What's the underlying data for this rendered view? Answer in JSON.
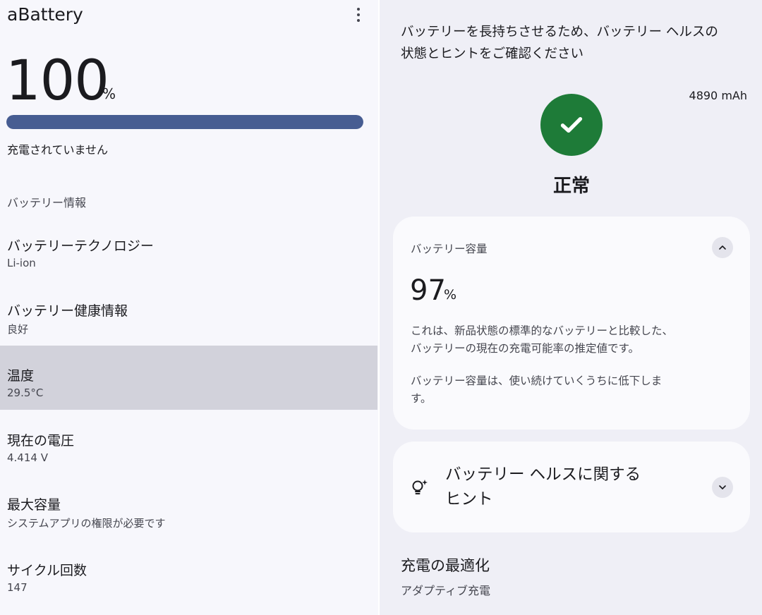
{
  "app": {
    "title": "aBattery"
  },
  "level": {
    "percent_value": "100",
    "percent_sign": "%",
    "fill_fraction": 1.0,
    "capacity_mah": "4890 mAh",
    "charge_status": "充電されていません"
  },
  "battery_info": {
    "section_title": "バッテリー情報",
    "items": [
      {
        "title": "バッテリーテクノロジー",
        "value": "Li-ion"
      },
      {
        "title": "バッテリー健康情報",
        "value": "良好"
      },
      {
        "title": "温度",
        "value": "29.5°C"
      },
      {
        "title": "現在の電圧",
        "value": "4.414 V"
      },
      {
        "title": "最大容量",
        "value": "システムアプリの権限が必要です"
      },
      {
        "title": "サイクル回数",
        "value": "147"
      }
    ]
  },
  "health": {
    "intro_line1": "バッテリーを長持ちさせるため、バッテリー ヘルスの",
    "intro_line2": "状態とヒントをご確認ください",
    "status_label": "正常",
    "status_color": "#1e7b38",
    "capacity_card": {
      "title": "バッテリー容量",
      "value": "97",
      "unit": "%",
      "desc1_line1": "これは、新品状態の標準的なバッテリーと比較した、",
      "desc1_line2": "バッテリーの現在の充電可能率の推定値です。",
      "desc2_line1": "バッテリー容量は、使い続けていくうちに低下しま",
      "desc2_line2": "す。"
    },
    "tips_card": {
      "title_line1": "バッテリー ヘルスに関する",
      "title_line2": "ヒント"
    },
    "optimize": {
      "title": "充電の最適化",
      "subtitle": "アダプティブ充電"
    }
  },
  "colors": {
    "accent": "#475d92",
    "track": "#d8dbe8",
    "highlight_row": "#d2d2db"
  }
}
